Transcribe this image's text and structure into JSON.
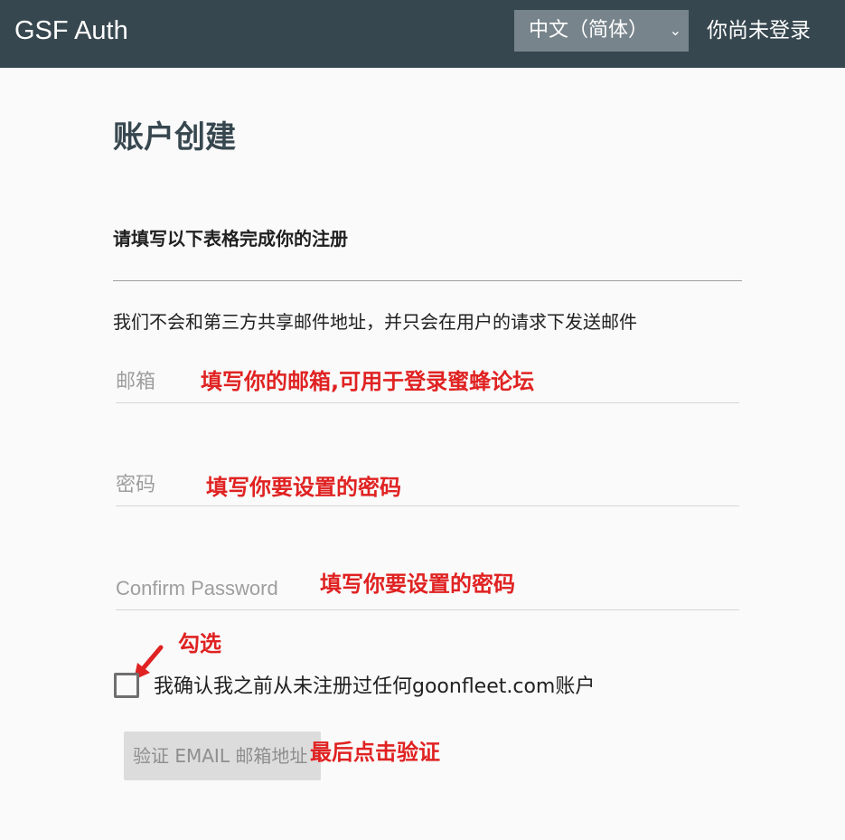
{
  "navbar": {
    "brand": "GSF Auth",
    "language": "中文（简体）",
    "login_status": "你尚未登录"
  },
  "page": {
    "title": "账户创建",
    "subtitle": "请填写以下表格完成你的注册",
    "privacy_note": "我们不会和第三方共享邮件地址，并只会在用户的请求下发送邮件"
  },
  "form": {
    "email_placeholder": "邮箱",
    "password_placeholder": "密码",
    "confirm_placeholder": "Confirm Password",
    "checkbox_label": "我确认我之前从未注册过任何goonfleet.com账户",
    "checkbox_checked": false,
    "submit_label": "验证 EMAIL 邮箱地址"
  },
  "annotations": {
    "email": "填写你的邮箱,可用于登录蜜蜂论坛",
    "password": "填写你要设置的密码",
    "confirm": "填写你要设置的密码",
    "checkbox": "勾选",
    "submit": "最后点击验证"
  },
  "colors": {
    "navbar": "#37474f",
    "annotation": "#e02222",
    "button_disabled": "#dcdcdc"
  },
  "icons": {
    "dropdown": "chevron-down-icon",
    "pointer": "arrow-icon"
  }
}
